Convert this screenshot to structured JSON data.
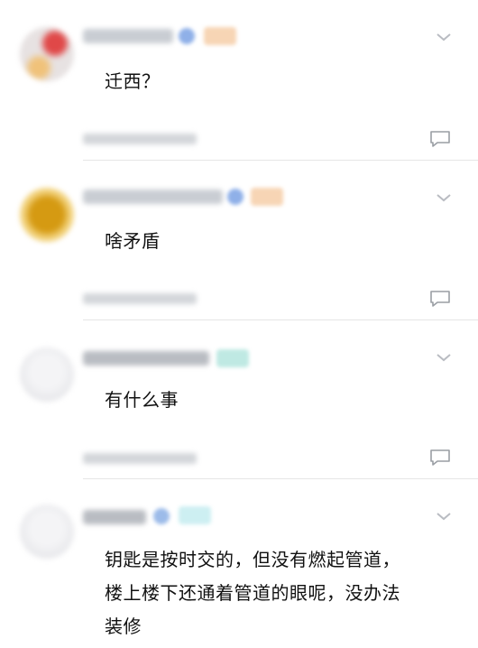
{
  "comments": [
    {
      "text": "迁西？"
    },
    {
      "text": "啥矛盾"
    },
    {
      "text": "有什么事"
    },
    {
      "text": "钥匙是按时交的，但没有燃起管道，楼上楼下还通着管道的眼呢，没办法装修"
    }
  ],
  "icons": {
    "expand": "chevron-down-icon",
    "reply": "comment-reply-icon"
  }
}
